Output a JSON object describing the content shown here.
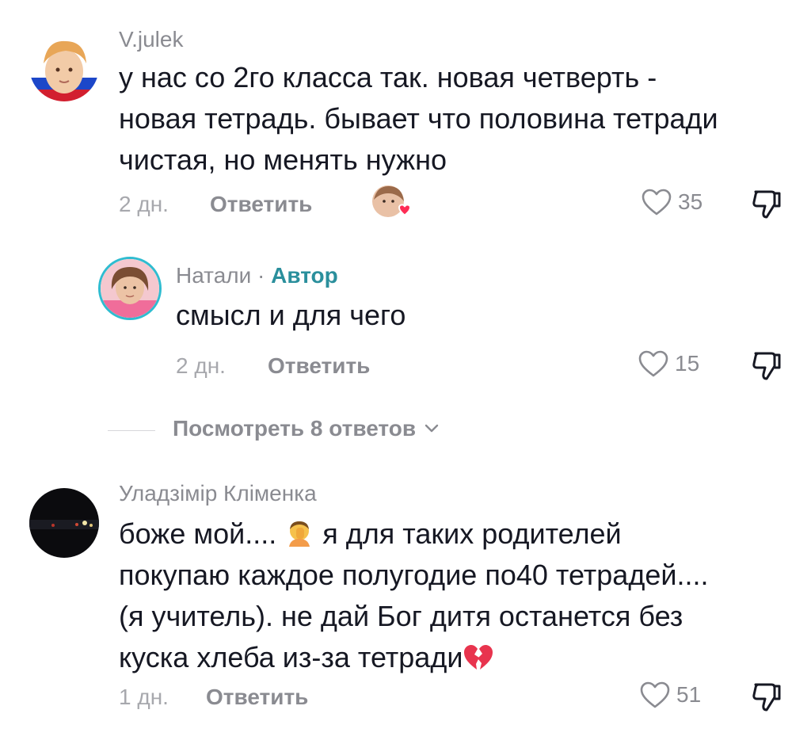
{
  "comments": [
    {
      "username": "V.julek",
      "lines": [
        "у нас со 2го класса так. новая четверть -",
        "новая тетрадь. бывает что половина тетради",
        "чистая, но менять нужно"
      ],
      "time": "2 дн.",
      "reply_label": "Ответить",
      "likes": "35",
      "liked_by_author_icon": "author-avatar-heart-icon"
    },
    {
      "username": "Натали",
      "separator": "·",
      "author_badge": "Автор",
      "lines": [
        "смысл и для чего"
      ],
      "time": "2 дн.",
      "reply_label": "Ответить",
      "likes": "15"
    },
    {
      "username": "Уладзімір Кліменка",
      "lines": [
        "боже мой.... ",
        "я для таких родителей",
        "покупаю каждое полугодие по40 тетрадей....",
        "(я учитель). не дай Бог дитя останется без",
        "куска хлеба из-за тетради"
      ],
      "time": "1 дн.",
      "reply_label": "Ответить",
      "likes": "51"
    }
  ],
  "view_replies_label": "Посмотреть 8 ответов",
  "colors": {
    "text": "#161823",
    "secondary": "#8a8b91",
    "author_accent": "#2a8f9c",
    "heart_emoji": "#e8344e"
  }
}
